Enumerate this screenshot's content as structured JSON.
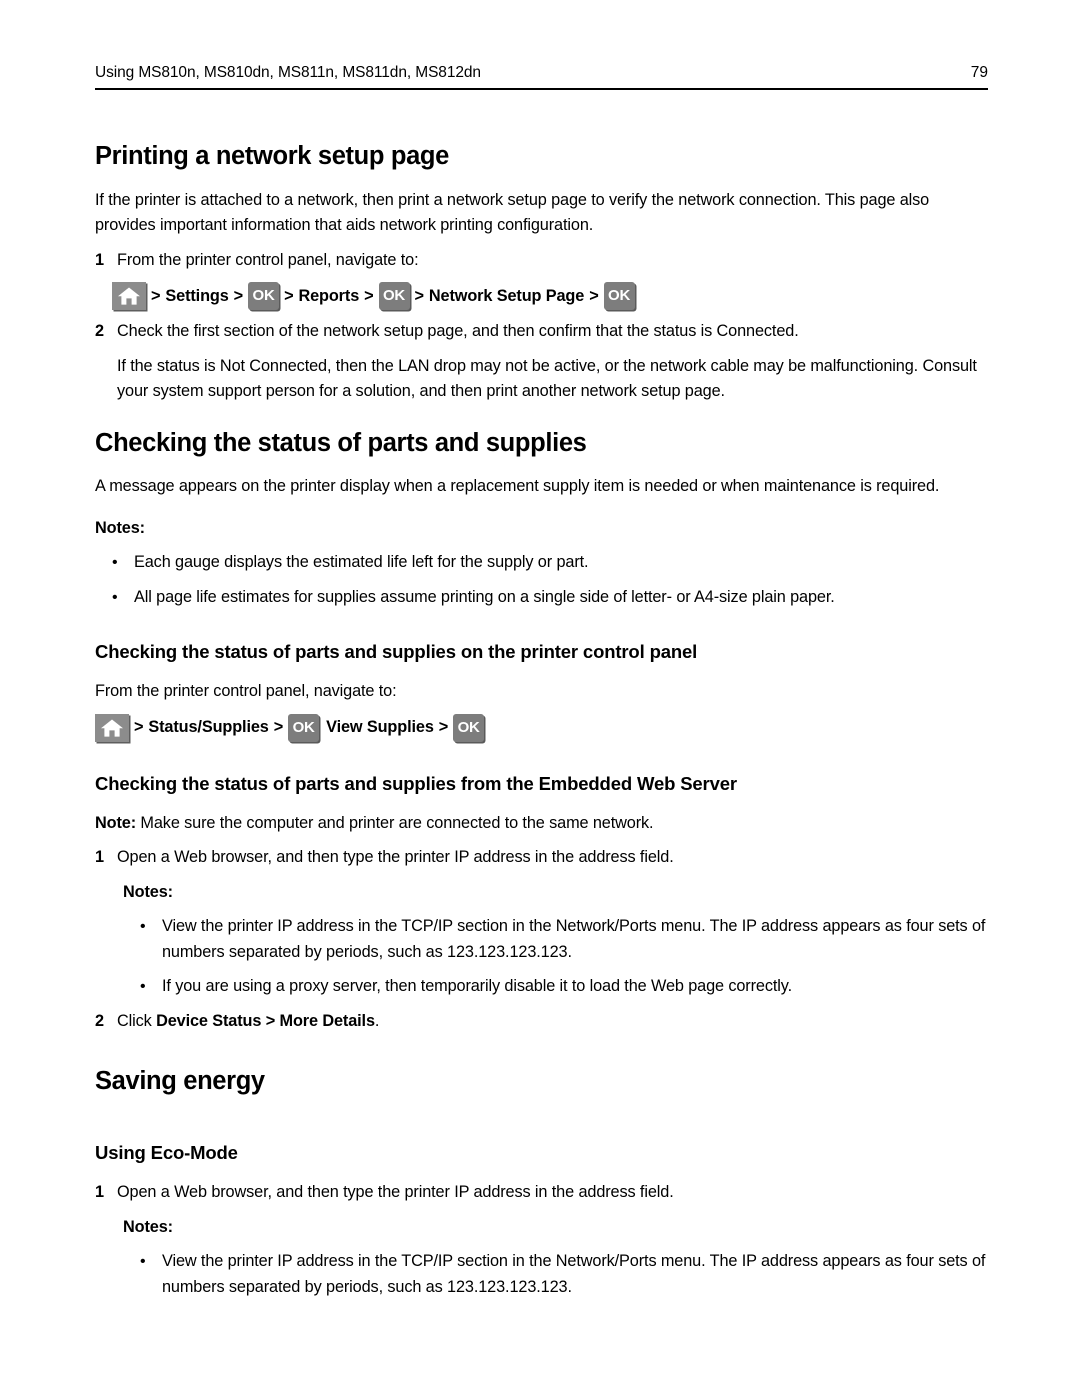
{
  "header": {
    "title": "Using MS810n, MS810dn, MS811n, MS811dn, MS812dn",
    "page_number": "79"
  },
  "icons": {
    "home": "home-icon",
    "ok": "OK"
  },
  "separator": ">",
  "sections": [
    {
      "id": "printing-network-setup-page",
      "heading": "Printing a network setup page",
      "intro": "If the printer is attached to a network, then print a network setup page to verify the network connection. This page also provides important information that aids network printing configuration.",
      "step1_num": "1",
      "step1_text": "From the printer control panel, navigate to:",
      "navpath": {
        "label_settings": "Settings",
        "label_reports": "Reports",
        "label_network_setup_page": "Network Setup Page"
      },
      "step2_num": "2",
      "step2_text": "Check the first section of the network setup page, and then confirm that the status is Connected.",
      "step2_cont": "If the status is Not Connected, then the LAN drop may not be active, or the network cable may be malfunctioning. Consult your system support person for a solution, and then print another network setup page."
    },
    {
      "id": "checking-status-parts-supplies",
      "heading": "Checking the status of parts and supplies",
      "intro": "A message appears on the printer display when a replacement supply item is needed or when maintenance is required.",
      "notes_label": "Notes:",
      "notes": [
        "Each gauge displays the estimated life left for the supply or part.",
        "All page life estimates for supplies assume printing on a single side of letter- or A4-size plain paper."
      ]
    },
    {
      "id": "checking-status-control-panel",
      "heading": "Checking the status of parts and supplies on the printer control panel",
      "intro": "From the printer control panel, navigate to:",
      "navpath": {
        "label_status_supplies": "Status/Supplies",
        "label_view_supplies": "View Supplies"
      }
    },
    {
      "id": "checking-status-embedded-web-server",
      "heading": "Checking the status of parts and supplies from the Embedded Web Server",
      "note_label": "Note:",
      "note_text": "Make sure the computer and printer are connected to the same network.",
      "step1_num": "1",
      "step1_text": "Open a Web browser, and then type the printer IP address in the address field.",
      "notes_label": "Notes:",
      "notes": [
        "View the printer IP address in the TCP/IP section in the Network/Ports menu. The IP address appears as four sets of numbers separated by periods, such as 123.123.123.123.",
        "If you are using a proxy server, then temporarily disable it to load the Web page correctly."
      ],
      "step2_num": "2",
      "step2_prefix": "Click ",
      "step2_bold1": "Device Status",
      "step2_sep": " > ",
      "step2_bold2": "More Details",
      "step2_suffix": "."
    },
    {
      "id": "saving-energy",
      "heading": "Saving energy"
    },
    {
      "id": "using-eco-mode",
      "heading": "Using Eco-Mode",
      "step1_num": "1",
      "step1_text": "Open a Web browser, and then type the printer IP address in the address field.",
      "notes_label": "Notes:",
      "notes": [
        "View the printer IP address in the TCP/IP section in the Network/Ports menu. The IP address appears as four sets of numbers separated by periods, such as 123.123.123.123."
      ]
    }
  ],
  "colors": {
    "text": "#000000",
    "background": "#ffffff",
    "button_gray": "#7d7d7d",
    "button_shadow": "#5a5a5a",
    "home_gray": "#8c8c8c"
  }
}
